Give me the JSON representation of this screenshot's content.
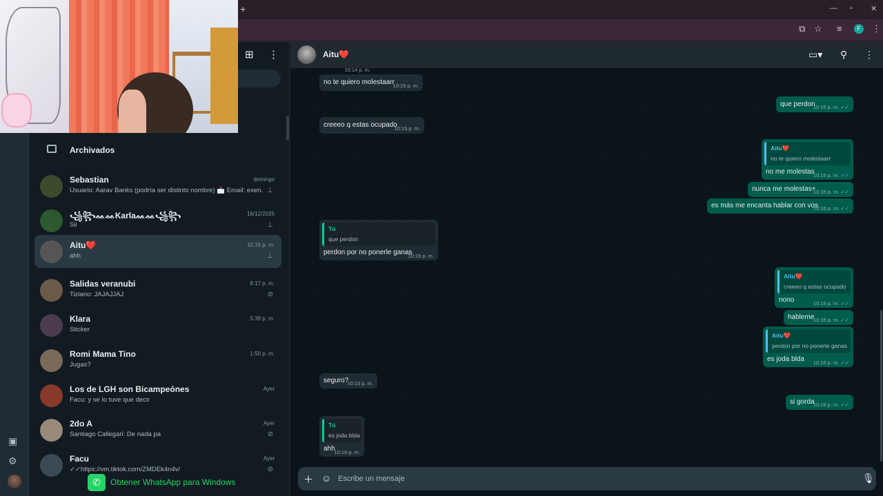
{
  "browser": {
    "new_tab": "+",
    "profile_initial": "F"
  },
  "sidebar": {
    "archived_label": "Archivados",
    "chats": [
      {
        "name": "Sebastian",
        "time": "domingo",
        "preview": "Usuario: Aarav Banks (podría ser distinto nombre) 📩 Email: exen...",
        "status_icon": "pin-icon",
        "avatar_color": "#3d4a2c"
      },
      {
        "name": "꧁꧂ᨐᨐKarlaᨐᨐ꧁꧂",
        "time": "16/12/2025",
        "preview": "Sii",
        "status_icon": "pin-icon",
        "avatar_color": "#2c5a2e"
      },
      {
        "name": "Aitu❤️",
        "time": "10:16 p. m.",
        "preview": "ahh",
        "status_icon": "pin-icon",
        "avatar_color": "#555555",
        "active": true
      },
      {
        "name": "Salidas veranubi",
        "time": "8:17 p. m.",
        "preview": "Tiziano: JAJAJJAJ",
        "status_icon": "mute-icon",
        "avatar_color": "#6b5a4a"
      },
      {
        "name": "Klara",
        "time": "5:39 p. m.",
        "preview": "Sticker",
        "status_icon": "",
        "avatar_color": "#4a3b4f"
      },
      {
        "name": "Romi Mama Tino",
        "time": "1:50 p. m.",
        "preview": "Jugas?",
        "status_icon": "",
        "avatar_color": "#7a6a5a"
      },
      {
        "name": "Los de LGH son Bicampeónes",
        "time": "Ayer",
        "preview": "Facu: y se lo tuve que decir",
        "status_icon": "",
        "avatar_color": "#8a3a2a"
      },
      {
        "name": "2do A",
        "time": "Ayer",
        "preview": "Santiago Callegari: De nada pa",
        "status_icon": "mute-icon",
        "avatar_color": "#9a8a7a"
      },
      {
        "name": "Facu",
        "time": "Ayer",
        "preview": "✓✓https://vm.tiktok.com/ZMDEk4n4v/",
        "status_icon": "mute-icon",
        "avatar_color": "#3b4a54"
      }
    ],
    "get_app_label": "Obtener WhatsApp para Windows"
  },
  "conversation": {
    "contact_name": "Aitu❤️",
    "composer_placeholder": "Escribe un mensaje",
    "messages": [
      {
        "dir": "in",
        "text": "",
        "time": "10:14 p. m."
      },
      {
        "dir": "in",
        "text": "no te quiero molestaarr",
        "time": "10:15 p. m."
      },
      {
        "dir": "out",
        "text": "que perdon",
        "time": "10:15 p. m."
      },
      {
        "dir": "in",
        "text": "creeeo q estas ocupado",
        "time": "10:15 p. m."
      },
      {
        "dir": "out",
        "quote_author": "Aitu❤️",
        "quote_text": "no te quiero molestaarr",
        "text": "no me molestas",
        "time": "10:15 p. m."
      },
      {
        "dir": "out",
        "text": "nunca me molestas+",
        "time": "10:15 p. m."
      },
      {
        "dir": "out",
        "text": "es más me encanta hablar con vos",
        "time": "10:15 p. m."
      },
      {
        "dir": "in",
        "quote_author": "Tú",
        "quote_text": "que perdon",
        "text": "perdon por no ponerle ganas",
        "time": "10:15 p. m."
      },
      {
        "dir": "out",
        "quote_author": "Aitu❤️",
        "quote_text": "creeeo q estas ocupado",
        "text": "nono",
        "time": "10:15 p. m."
      },
      {
        "dir": "out",
        "text": "hableme",
        "time": "10:15 p. m."
      },
      {
        "dir": "out",
        "quote_author": "Aitu❤️",
        "quote_text": "perdon por no ponerle ganas",
        "text": "es joda blda",
        "time": "10:15 p. m."
      },
      {
        "dir": "in",
        "text": "seguro?",
        "time": "10:15 p. m."
      },
      {
        "dir": "out",
        "text": "si gorda",
        "time": "10:16 p. m."
      },
      {
        "dir": "in",
        "quote_author": "Tú",
        "quote_text": "es joda blda",
        "text": "ahh",
        "time": "10:16 p. m."
      }
    ]
  },
  "colors": {
    "accent": "#25d366",
    "out_bubble": "#005c4b",
    "in_bubble": "#202c33",
    "quote_bar": "#06cf9c"
  }
}
